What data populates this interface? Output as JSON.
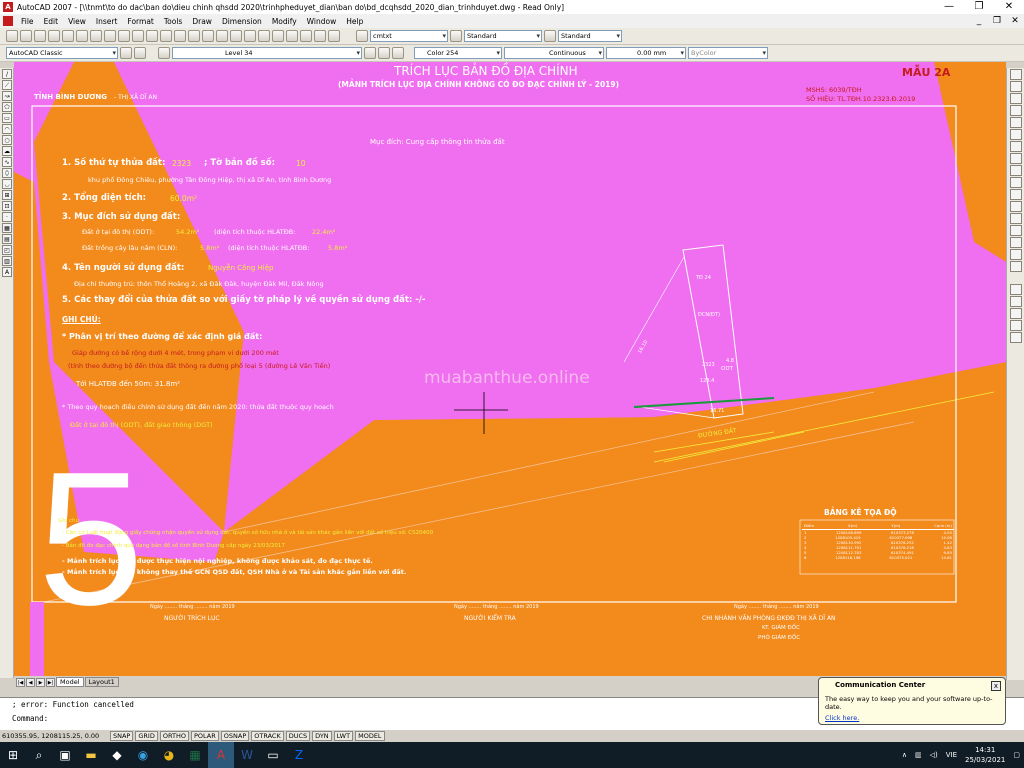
{
  "window": {
    "title": "AutoCAD 2007 - [\\\\tnmt\\to do dac\\ban do\\dieu chinh qhsdd 2020\\trinhpheduyet_dian\\ban do\\bd_dcqhsdd_2020_dian_trinhduyet.dwg - Read Only]",
    "min": "—",
    "max": "❐",
    "close": "✕"
  },
  "menu": [
    "File",
    "Edit",
    "View",
    "Insert",
    "Format",
    "Tools",
    "Draw",
    "Dimension",
    "Modify",
    "Window",
    "Help"
  ],
  "doc_ctrls": {
    "min": "_",
    "max": "❐",
    "close": "✕"
  },
  "toolbar": {
    "textstyle": "cmtxt",
    "dimstyle": "Standard",
    "tablestyle": "Standard",
    "workspace": "AutoCAD Classic",
    "layer": "Level 34",
    "color": "Color 254",
    "linetype": "Continuous",
    "lineweight": "0.00 mm",
    "plotstyle": "ByColor"
  },
  "drawing": {
    "title": "TRÍCH LỤC BẢN ĐỒ ĐỊA CHÍNH",
    "subtitle": "(MẢNH TRÍCH LỤC ĐỊA CHÍNH KHÔNG CÓ ĐO ĐẠC CHỈNH LÝ - 2019)",
    "form_no": "MẪU 2A",
    "mshs": "MSHS:  6039/TĐH",
    "so_hieu": "SỐ HIỆU: TL.TĐH.10.2323.Đ.2019",
    "province": "TỈNH BÌNH DƯƠNG",
    "town": "- THỊ XÃ DĨ AN",
    "purpose": "Mục đích: Cung cấp thông tin thửa đất",
    "lot_no_label": "1. Số thứ tự thửa đất:",
    "lot_no": "2323",
    "sheet_no_label": "; Tờ bản đồ số:",
    "sheet_no": "10",
    "address": "khu phố Đông Chiêu, phường Tân Đông Hiệp, thị xã Dĩ An, tỉnh Bình Dương",
    "area_label": "2. Tổng diện tích:",
    "area": "60.0m²",
    "use_label": "3. Mục đích sử dụng đất:",
    "use_odt": "Đất ở tại đô thị (ODT):",
    "use_odt_val": "54.2m²",
    "use_odt_note": "(diện tích thuộc HLATĐB:",
    "use_odt_hl": "22.4m²",
    "use_cln": "Đất trồng cây lâu năm (CLN):",
    "use_cln_val": "5.8m²",
    "use_cln_note": "(diện tích thuộc HLATĐB:",
    "use_cln_hl": "5.8m²",
    "owner_label": "4. Tên người sử dụng đất:",
    "owner": "Nguyễn Công Hiệp",
    "owner_addr": "Địa chỉ thường trú: thôn Thổ Hoàng 2, xã Đăk Đăk, huyện Đăk Mil, Đăk Nông",
    "changes_label": "5. Các thay đổi của thửa đất so với giấy tờ pháp lý về quyền sử dụng đất: -/-",
    "note_label": "GHI CHÚ:",
    "price_label": "* Phân vị trí theo đường để xác định giá đất:",
    "price1": "Giáp đường có bề rộng dưới 4 mét, trong phạm vi dưới 200 mét",
    "price2": "(tính theo đường bộ đến thửa đất thông ra đường phố loại 5 (đường Lê Văn Tiến)",
    "hlatdb": "Tới HLATĐB đến 50m: 31.8m²",
    "plan_note": "* Theo quy hoạch điều chỉnh sử dụng đất đến năm 2020: thửa đất thuộc quy hoạch",
    "plan_use": "Đất ở tại đô thị (ODT), đất giao thông (DGT)",
    "watermark": "muabanthue.online",
    "bottom_note1": "Ghi chú:",
    "bottom_note2": "- Căn cứ Luật hoạt động giấy chứng nhận quyền sử dụng đất, quyền sở hữu nhà ở và tài sản khác gắn liền với đất số hiệu sở: CS20400",
    "bottom_note3": "- Bản đồ đo đạc chính quy dạng bản đồ số tỉnh Bình Dương cấp ngày 23/03/2017",
    "bottom_note4": "- Mảnh trích lục này được thực hiện nội nghiệp, không được khảo sát, đo đạc thực tế.",
    "bottom_note5": "- Mảnh trích lục này không thay thế GCN QSD đất, QSH Nhà ở và Tài sản khác gắn liền với đất.",
    "sign_date": "Ngày ........ tháng ........ năm 2019",
    "sign1": "NGƯỜI TRÍCH LỤC",
    "sign2": "NGƯỜI KIỂM TRA",
    "sign3": "CHI NHÁNH VĂN PHÒNG ĐKĐĐ THỊ XÃ DĨ AN",
    "sign3b": "KT. GIÁM ĐỐC",
    "sign3c": "PHÓ GIÁM ĐỐC",
    "coord_title": "BẢNG KÊ TỌA ĐỘ",
    "coord_headers": [
      "Điểm",
      "X(m)",
      "Y(m)",
      "Cạnh (m)"
    ],
    "coord_rows": [
      [
        "1",
        "1208108.899",
        "610373.278",
        "4.05"
      ],
      [
        "2",
        "1208105.419",
        "610377.098",
        "15.08"
      ],
      [
        "3",
        "1208110.992",
        "610376.252",
        "1.42"
      ],
      [
        "4",
        "1208111.791",
        "610376.218",
        "4.83"
      ],
      [
        "5",
        "1208112.783",
        "610374.491",
        "9.85"
      ],
      [
        "6",
        "1208116.198",
        "610375.021",
        "14.81"
      ]
    ],
    "map_labels": {
      "lot_top": "TĐ 24",
      "lot_mid": "ĐCN(ĐT)",
      "lot_code": "2323",
      "lot_area": "123.4",
      "odt": "ODT",
      "road": "ĐƯỜNG ĐẤT",
      "road_len": "16.71",
      "lot_dim": "4.8",
      "left_dim": "16.10",
      "big5": "5"
    }
  },
  "tabs": {
    "model": "Model",
    "layout": "Layout1"
  },
  "command": {
    "line1": "; error: Function cancelled",
    "line2": "Command:"
  },
  "status": {
    "coords": "610355.95, 1208115.25, 0.00",
    "toggles": [
      "SNAP",
      "GRID",
      "ORTHO",
      "POLAR",
      "OSNAP",
      "OTRACK",
      "DUCS",
      "DYN",
      "LWT",
      "MODEL"
    ]
  },
  "comm_center": {
    "title": "Communication Center",
    "body": "The easy way to keep you and your software up-to-date.",
    "link": "Click here.",
    "close": "x"
  },
  "taskbar": {
    "icons": [
      "start-icon",
      "search-icon",
      "task-view-icon",
      "file-explorer-icon",
      "app-icon",
      "edge-icon",
      "chrome-icon",
      "excel-icon",
      "autocad-icon",
      "word-icon",
      "explorer-icon",
      "zalo-icon"
    ],
    "lang": "VIE",
    "time": "14:31",
    "date": "25/03/2021"
  },
  "colors": {
    "canvas_magenta": "#f06ef0",
    "orange": "#f28a1c",
    "yellow_text": "#f3ee3c"
  }
}
